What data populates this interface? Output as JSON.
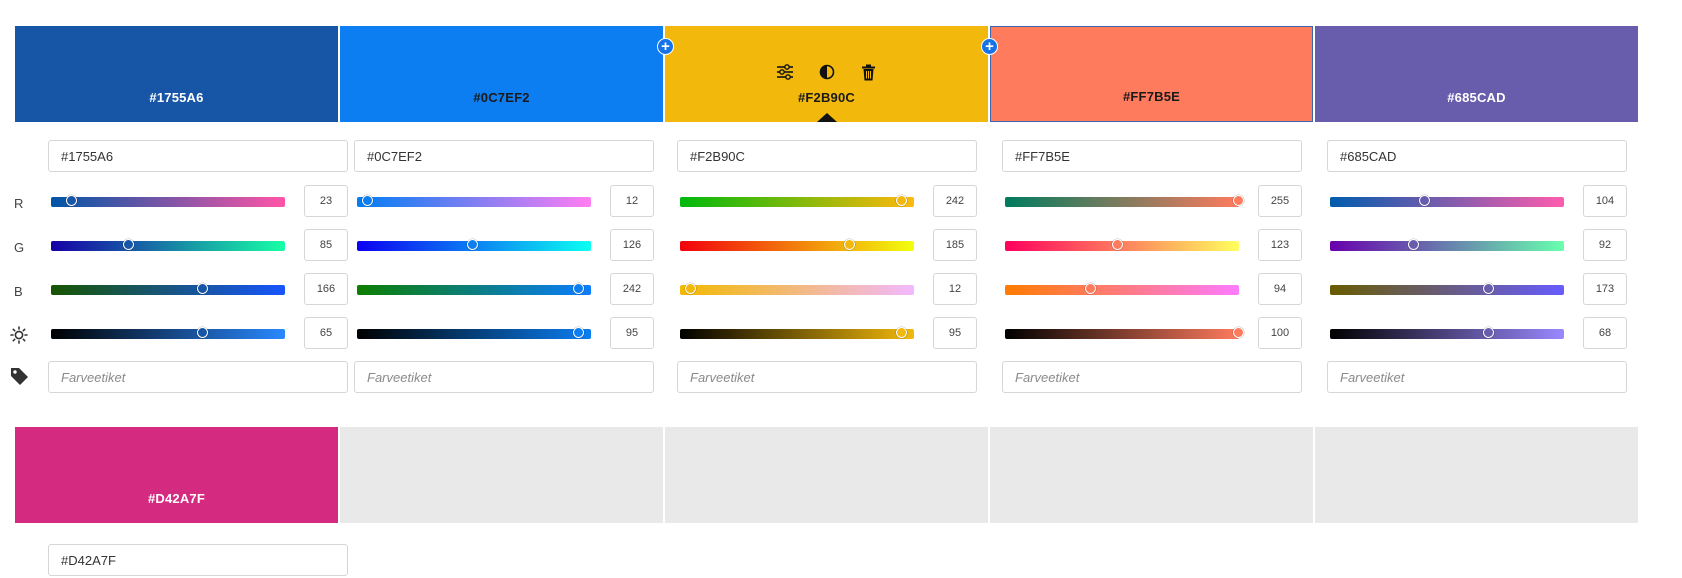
{
  "palette": [
    {
      "hex": "#1755A6",
      "r": 23,
      "g": 85,
      "b": 166,
      "brightness": 65,
      "label_text": "light",
      "tag_placeholder": "Farveetiket",
      "grad_r": [
        "#0055a6",
        "#ff55a6"
      ],
      "grad_g": [
        "#1700a6",
        "#17ffa6"
      ],
      "grad_b": [
        "#175500",
        "#1755ff"
      ],
      "grad_l": [
        "#000000",
        "#2a88ff"
      ]
    },
    {
      "hex": "#0C7EF2",
      "r": 12,
      "g": 126,
      "b": 242,
      "brightness": 95,
      "label_text": "dark",
      "tag_placeholder": "Farveetiket",
      "grad_r": [
        "#007ef2",
        "#ff7ef2"
      ],
      "grad_g": [
        "#0c00f2",
        "#0cfff2"
      ],
      "grad_b": [
        "#0c7e00",
        "#0c7eff"
      ],
      "grad_l": [
        "#000000",
        "#0c7ef2"
      ]
    },
    {
      "hex": "#F2B90C",
      "r": 242,
      "g": 185,
      "b": 12,
      "brightness": 95,
      "label_text": "dark",
      "tag_placeholder": "Farveetiket",
      "grad_r": [
        "#00b90c",
        "#ffb90c"
      ],
      "grad_g": [
        "#f2000c",
        "#f2ff0c"
      ],
      "grad_b": [
        "#f2b900",
        "#f2b9ff"
      ],
      "grad_l": [
        "#000000",
        "#f2b90c"
      ]
    },
    {
      "hex": "#FF7B5E",
      "r": 255,
      "g": 123,
      "b": 94,
      "brightness": 100,
      "label_text": "dark",
      "tag_placeholder": "Farveetiket",
      "grad_r": [
        "#007b5e",
        "#ff7b5e"
      ],
      "grad_g": [
        "#ff005e",
        "#ffff5e"
      ],
      "grad_b": [
        "#ff7b00",
        "#ff7bff"
      ],
      "grad_l": [
        "#000000",
        "#ff7b5e"
      ]
    },
    {
      "hex": "#685CAD",
      "r": 104,
      "g": 92,
      "b": 173,
      "brightness": 68,
      "label_text": "light",
      "tag_placeholder": "Farveetiket",
      "grad_r": [
        "#005cad",
        "#ff5cad"
      ],
      "grad_g": [
        "#6800ad",
        "#68ffad"
      ],
      "grad_b": [
        "#685c00",
        "#685cff"
      ],
      "grad_l": [
        "#000000",
        "#9a88ff"
      ]
    },
    {
      "hex": "#D42A7F",
      "label_text": "light"
    }
  ],
  "row_labels": {
    "r": "R",
    "g": "G",
    "b": "B"
  },
  "icons": {
    "brightness": "sun-icon",
    "tag": "tag-icon",
    "adjust": "sliders-icon",
    "contrast": "contrast-icon",
    "delete": "trash-icon",
    "add": "plus-icon"
  },
  "add_symbol": "+",
  "selected_index": 2,
  "empty_color": "#e9e9e9"
}
